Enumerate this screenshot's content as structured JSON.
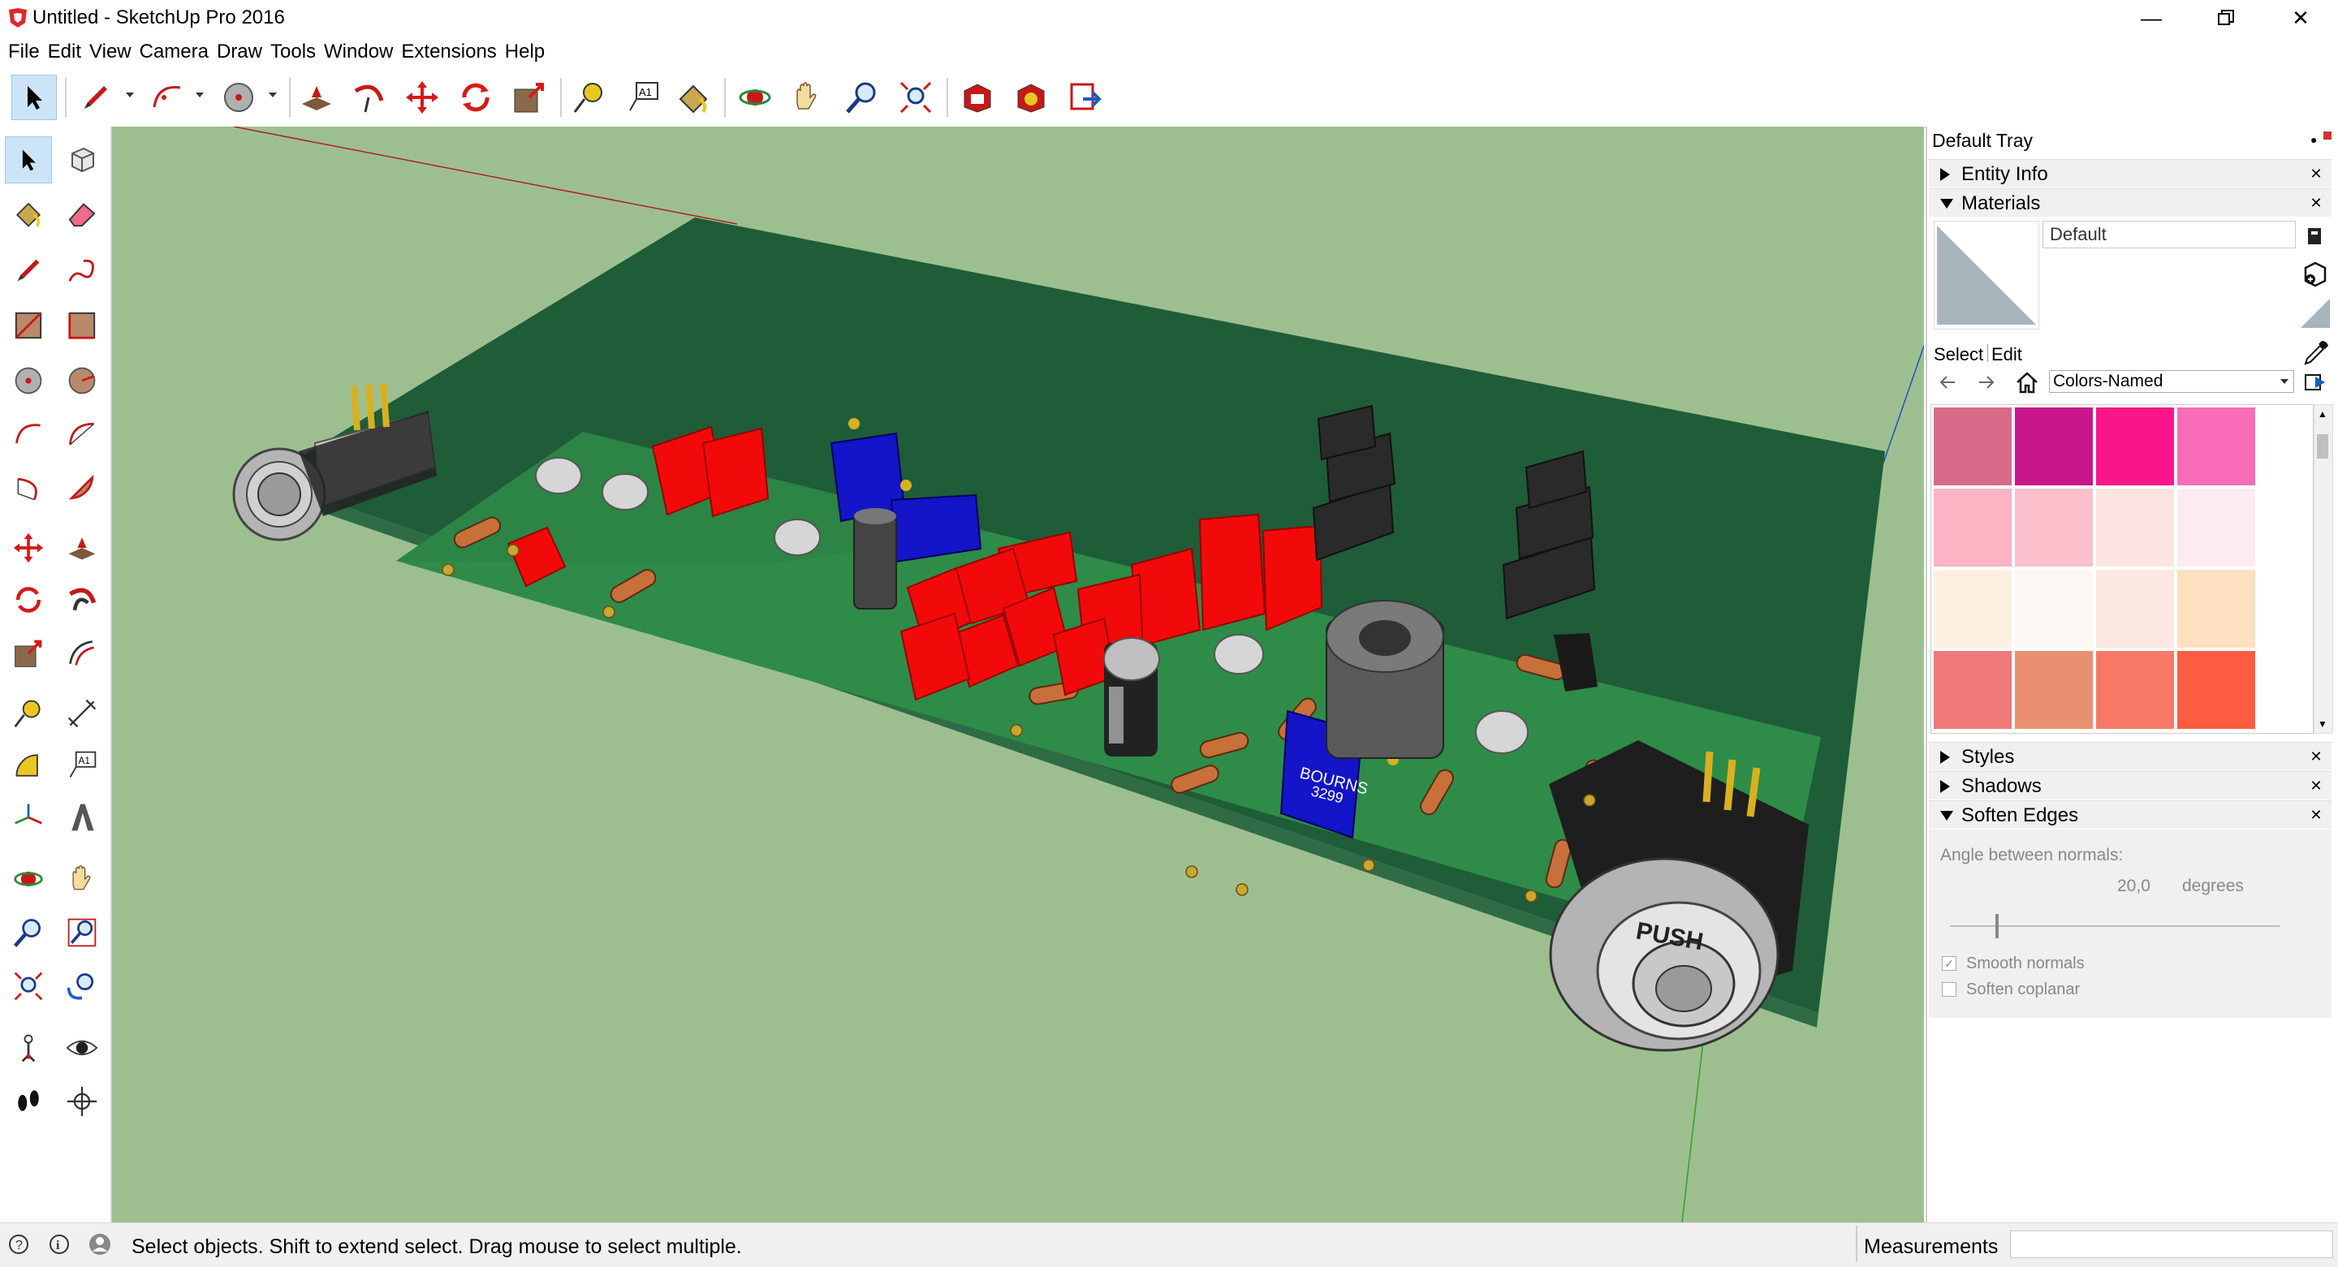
{
  "window": {
    "title": "Untitled - SketchUp Pro 2016"
  },
  "menu": [
    "File",
    "Edit",
    "View",
    "Camera",
    "Draw",
    "Tools",
    "Window",
    "Extensions",
    "Help"
  ],
  "toolbar_icons": [
    "select-icon",
    "pencil-icon",
    "arc-icon",
    "circle-icon",
    "pushpull-icon",
    "followme-icon",
    "move-icon",
    "rotate-icon",
    "scale-icon",
    "tape-measure-icon",
    "text-icon",
    "paint-bucket-icon",
    "orbit-icon",
    "pan-icon",
    "zoom-icon",
    "zoom-extents-icon",
    "warehouse-icon",
    "extension-warehouse-icon",
    "send-to-layout-icon"
  ],
  "tray": {
    "title": "Default Tray",
    "panels": {
      "entity_info": "Entity Info",
      "materials": "Materials",
      "styles": "Styles",
      "shadows": "Shadows",
      "soften_edges": "Soften Edges"
    },
    "materials": {
      "current_name": "Default",
      "select_tab": "Select",
      "edit_tab": "Edit",
      "collection": "Colors-Named",
      "swatches": [
        "#d86a8a",
        "#c8168a",
        "#f8168a",
        "#f86cb8",
        "#fcb4c4",
        "#fcc0cc",
        "#fce4e0",
        "#fcecf0",
        "#fcefe2",
        "#fdf7f3",
        "#fce8e0",
        "#fce0c0",
        "#ef7878",
        "#e89070",
        "#f87868",
        "#fc5c40"
      ]
    },
    "soften": {
      "angle_label": "Angle between normals:",
      "angle_value": "20,0",
      "angle_unit": "degrees",
      "smooth_normals": "Smooth normals",
      "soften_coplanar": "Soften coplanar",
      "smooth_checked": true,
      "coplanar_checked": false
    }
  },
  "pcb": {
    "label_bourns": "BOURNS",
    "label_part": "3299",
    "label_push": "PUSH"
  },
  "status": {
    "text": "Select objects. Shift to extend select. Drag mouse to select multiple.",
    "measurements_label": "Measurements"
  },
  "colors": {
    "viewport_bg": "#9dbf90",
    "board": "#215e3a",
    "board_top": "#1a5a32",
    "board_side": "#2f6b45",
    "inner": "#2d8a48",
    "red_cap": "#f00a0a",
    "blue_pot": "#1414c8"
  }
}
